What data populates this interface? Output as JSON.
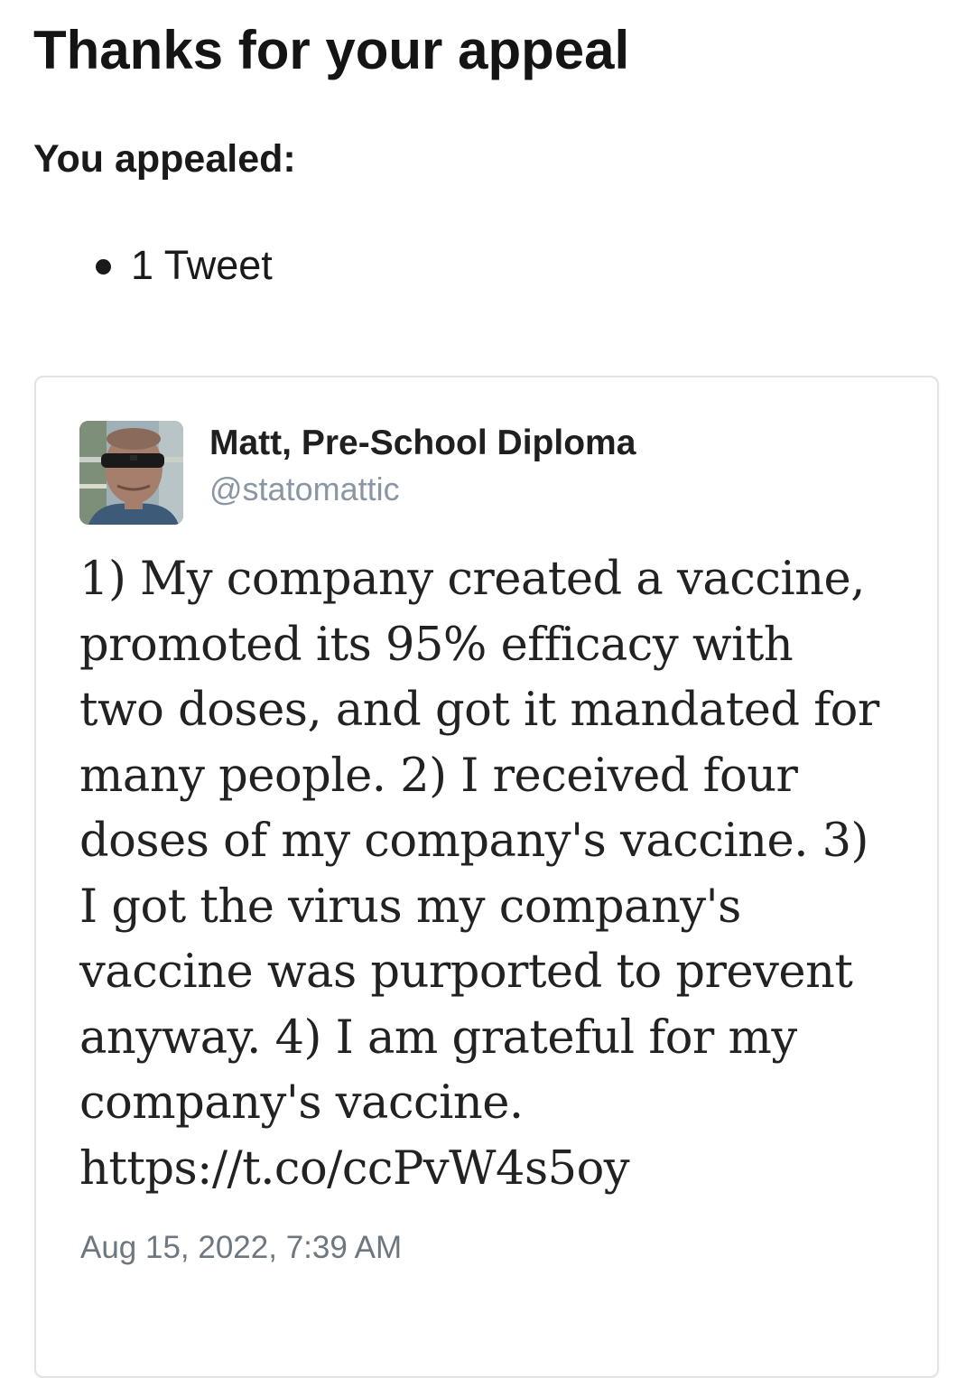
{
  "page": {
    "title": "Thanks for your appeal",
    "appealed_heading": "You appealed:",
    "appealed_items": [
      "1 Tweet"
    ]
  },
  "tweet": {
    "display_name": "Matt, Pre-School Diploma",
    "handle": "@statomattic",
    "avatar_icon": "profile-photo-sunglasses",
    "text_lines": [
      "1) My company created a vaccine,",
      "promoted its 95% efficacy with",
      "two doses, and got it mandated for",
      "many people. 2) I received four",
      "doses of my company's vaccine. 3)",
      "I got the virus my company's",
      "vaccine was purported to prevent",
      "anyway. 4) I am grateful for my",
      "company's vaccine.",
      "https://t.co/ccPvW4s5oy"
    ],
    "timestamp": "Aug 15, 2022, 7:39 AM"
  }
}
